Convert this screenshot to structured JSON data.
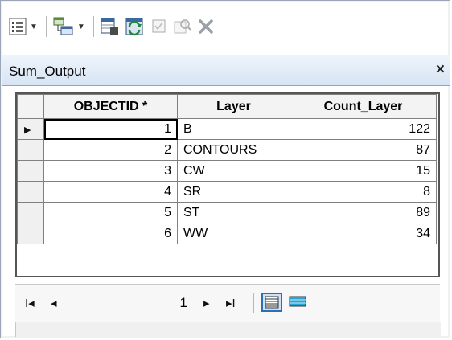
{
  "toolbar": {
    "icons": [
      "table-options-icon",
      "related-tables-icon",
      "select-by-attributes-icon",
      "switch-selection-icon",
      "clear-selection-icon",
      "zoom-to-selected-icon",
      "delete-selected-icon"
    ]
  },
  "panel": {
    "title": "Sum_Output",
    "close_label": "×"
  },
  "table": {
    "columns": [
      "OBJECTID *",
      "Layer",
      "Count_Layer"
    ],
    "rows": [
      {
        "objectid": "1",
        "layer": "B",
        "count": "122"
      },
      {
        "objectid": "2",
        "layer": "CONTOURS",
        "count": "87"
      },
      {
        "objectid": "3",
        "layer": "CW",
        "count": "15"
      },
      {
        "objectid": "4",
        "layer": "SR",
        "count": "8"
      },
      {
        "objectid": "5",
        "layer": "ST",
        "count": "89"
      },
      {
        "objectid": "6",
        "layer": "WW",
        "count": "34"
      }
    ]
  },
  "navigation": {
    "current_record": "1",
    "first": "I◂",
    "prev": "◂",
    "next": "▸",
    "last": "▸I"
  }
}
